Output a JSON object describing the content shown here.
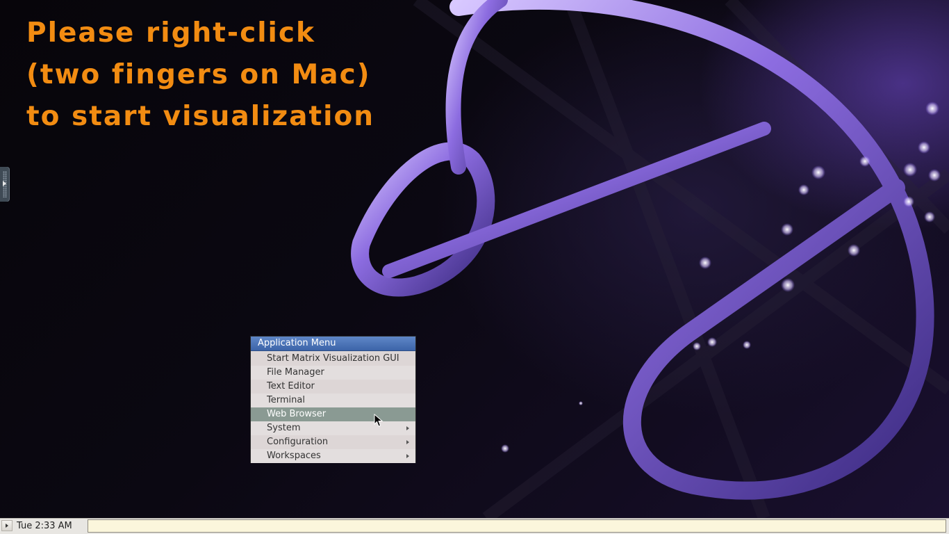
{
  "desktop": {
    "instruction_lines": [
      "Please right-click",
      "(two fingers on Mac)",
      "to start visualization"
    ],
    "accent_color": "#f28c12"
  },
  "app_menu": {
    "title": "Application Menu",
    "items": [
      {
        "label": "Start Matrix Visualization GUI",
        "submenu": false
      },
      {
        "label": "File Manager",
        "submenu": false
      },
      {
        "label": "Text Editor",
        "submenu": false
      },
      {
        "label": "Terminal",
        "submenu": false
      },
      {
        "label": "Web Browser",
        "submenu": false,
        "highlighted": true
      },
      {
        "label": "System",
        "submenu": true
      },
      {
        "label": "Configuration",
        "submenu": true
      },
      {
        "label": "Workspaces",
        "submenu": true
      }
    ]
  },
  "taskbar": {
    "clock": "Tue  2:33 AM"
  },
  "icons": {
    "start": "play-arrow-icon",
    "submenu": "submenu-arrow-icon",
    "side_handle": "expand-arrow-icon"
  }
}
